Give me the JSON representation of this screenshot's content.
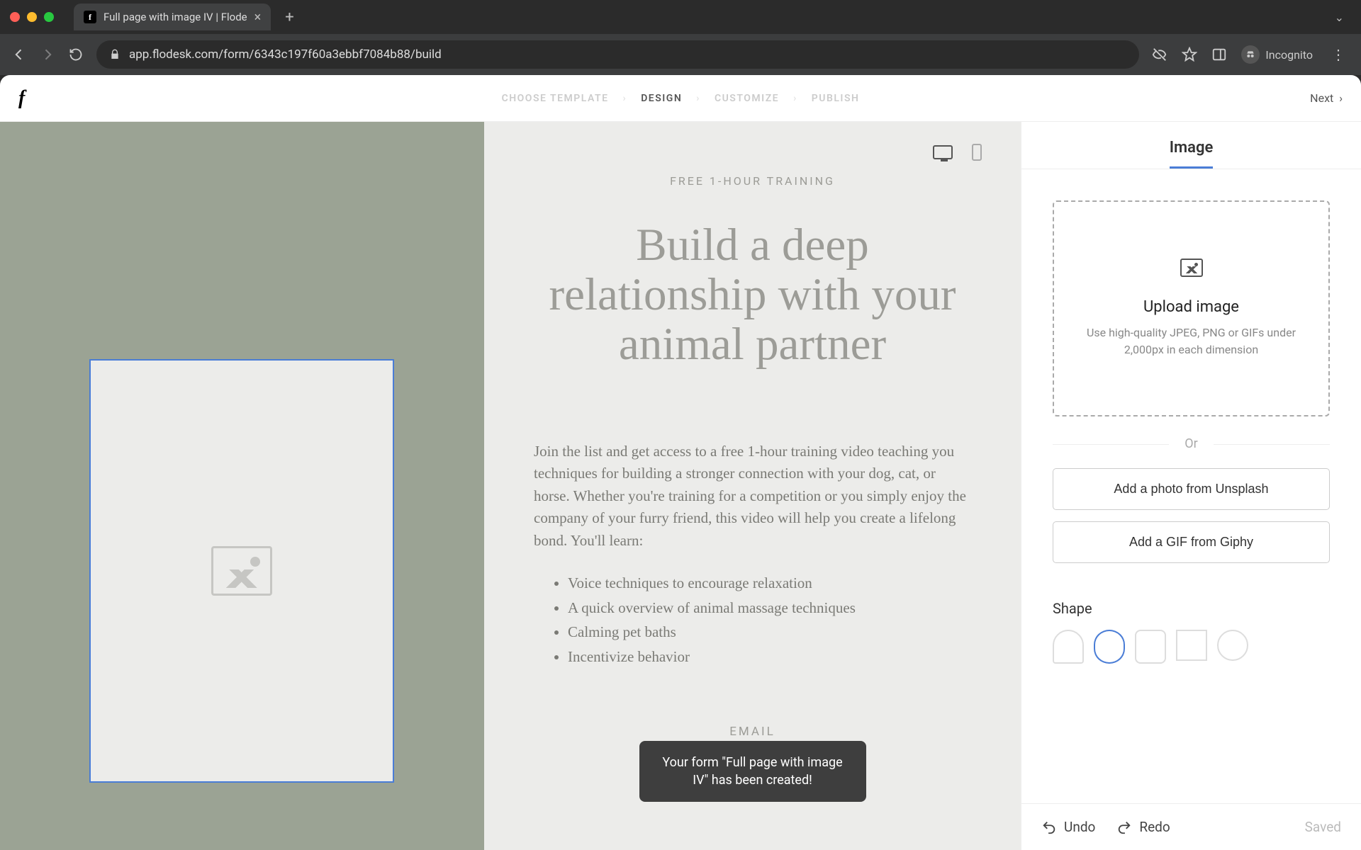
{
  "browser": {
    "tab_title": "Full page with image IV | Flode",
    "url": "app.flodesk.com/form/6343c197f60a3ebbf7084b88/build",
    "incognito_label": "Incognito"
  },
  "header": {
    "steps": [
      "CHOOSE TEMPLATE",
      "DESIGN",
      "CUSTOMIZE",
      "PUBLISH"
    ],
    "active_step_index": 1,
    "next_label": "Next"
  },
  "canvas": {
    "eyebrow": "FREE 1-HOUR TRAINING",
    "headline": "Build a deep relationship with your animal partner",
    "body": "Join the list and get access to a free 1-hour training video teaching you techniques for building a stronger connection with your dog, cat, or horse. Whether you're training for a competition or you simply enjoy the company of your furry friend, this video will help you create a lifelong bond. You'll learn:",
    "bullets": [
      "Voice techniques to encourage relaxation",
      "A quick overview of animal massage techniques",
      "Calming pet baths",
      "Incentivize behavior"
    ],
    "email_label": "EMAIL"
  },
  "toast": {
    "message": "Your form \"Full page with image IV\" has been created!"
  },
  "panel": {
    "tab_label": "Image",
    "upload_title": "Upload image",
    "upload_hint": "Use high-quality JPEG, PNG or GIFs under 2,000px in each dimension",
    "or_label": "Or",
    "unsplash_btn": "Add a photo from Unsplash",
    "giphy_btn": "Add a GIF from Giphy",
    "shape_label": "Shape",
    "selected_shape": "oval"
  },
  "bottombar": {
    "undo": "Undo",
    "redo": "Redo",
    "saved": "Saved"
  }
}
